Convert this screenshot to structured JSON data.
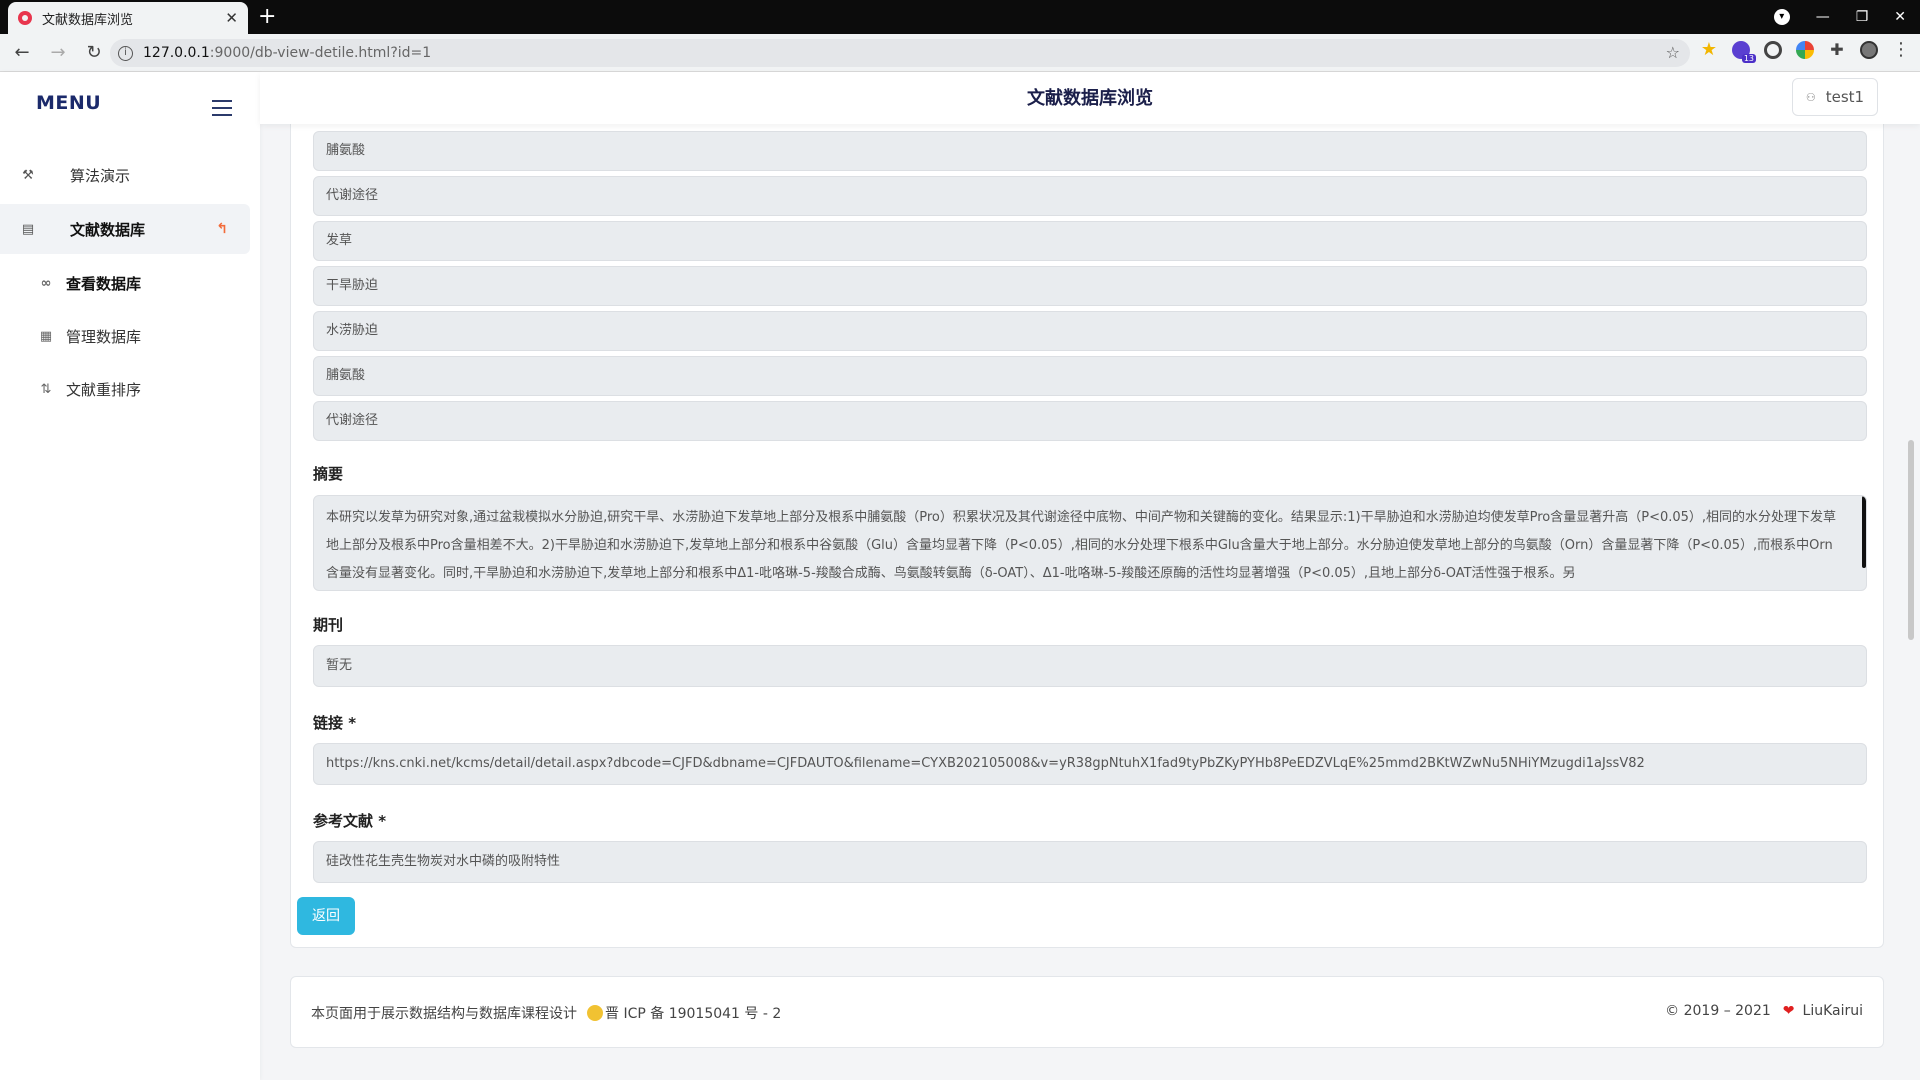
{
  "browser": {
    "tab_title": "文献数据库浏览",
    "url_host": "127.0.0.1",
    "url_path": ":9000/db-view-detile.html?id=1",
    "ext_badge": "13"
  },
  "sidebar": {
    "brand": "MENU",
    "items": [
      {
        "label": "算法演示"
      },
      {
        "label": "文献数据库"
      }
    ],
    "subitems": [
      {
        "label": "查看数据库"
      },
      {
        "label": "管理数据库"
      },
      {
        "label": "文献重排序"
      }
    ]
  },
  "header": {
    "title": "文献数据库浏览",
    "user": "test1"
  },
  "detail": {
    "keywords": [
      "脯氨酸",
      "代谢途径",
      "发草",
      "干旱胁迫",
      "水涝胁迫",
      "脯氨酸",
      "代谢途径"
    ],
    "abstract_label": "摘要",
    "abstract": "本研究以发草为研究对象,通过盆栽模拟水分胁迫,研究干旱、水涝胁迫下发草地上部分及根系中脯氨酸（Pro）积累状况及其代谢途径中底物、中间产物和关键酶的变化。结果显示:1)干旱胁迫和水涝胁迫均使发草Pro含量显著升高（P<0.05）,相同的水分处理下发草地上部分及根系中Pro含量相差不大。2)干旱胁迫和水涝胁迫下,发草地上部分和根系中谷氨酸（Glu）含量均显著下降（P<0.05）,相同的水分处理下根系中Glu含量大于地上部分。水分胁迫使发草地上部分的鸟氨酸（Orn）含量显著下降（P<0.05）,而根系中Orn含量没有显著变化。同时,干旱胁迫和水涝胁迫下,发草地上部分和根系中Δ1-吡咯琳-5-羧酸合成酶、鸟氨酸转氨酶（δ-OAT）、Δ1-吡咯琳-5-羧酸还原酶的活性均显著增强（P<0.05）,且地上部分δ-OAT活性强于根系。另",
    "journal_label": "期刊",
    "journal": "暂无",
    "link_label": "链接 *",
    "link": "https://kns.cnki.net/kcms/detail/detail.aspx?dbcode=CJFD&dbname=CJFDAUTO&filename=CYXB202105008&v=yR38gpNtuhX1fad9tyPbZKyPYHb8PeEDZVLqE%25mmd2BKtWZwNu5NHiYMzugdi1aJssV82",
    "ref_label": "参考文献 *",
    "ref": "硅改性花生壳生物炭对水中磷的吸附特性",
    "back_label": "返回"
  },
  "footer": {
    "left_text": "本页面用于展示数据结构与数据库课程设计",
    "icp": "晋 ICP 备 19015041 号 - 2",
    "copyright": "© 2019 – 2021",
    "author": "LiuKairui"
  },
  "colors": {
    "accent": "#2fb8e0",
    "caret": "#f26b3a",
    "heart": "#e02020"
  }
}
